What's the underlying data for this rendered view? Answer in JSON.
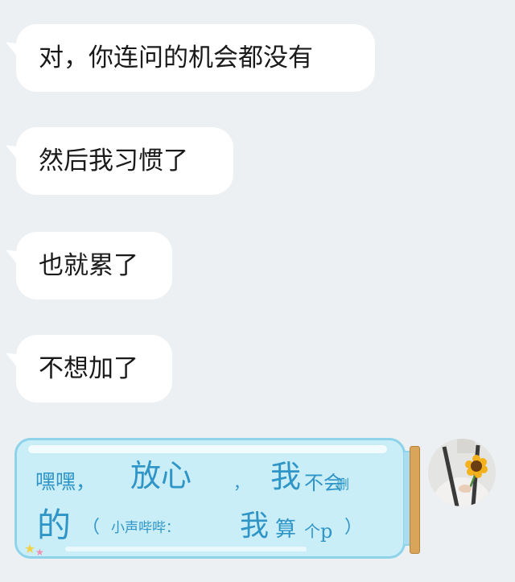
{
  "messages": [
    {
      "text": "对，你连问的机会都没有"
    },
    {
      "text": "然后我习惯了"
    },
    {
      "text": "也就累了"
    },
    {
      "text": "不想加了"
    }
  ],
  "sticker": {
    "line1": [
      "嘿嘿，",
      "放心",
      "，",
      "我",
      "不会",
      "删"
    ],
    "line2": [
      "的",
      "（",
      "小声哔哔：",
      "我",
      "算",
      "个",
      "p",
      "）"
    ]
  },
  "colors": {
    "background": "#edf0f3",
    "bubble": "#ffffff",
    "handwriting": "#2f94c6",
    "bottle_glass": "#c9eef8",
    "cork": "#d9a55a"
  },
  "icons": {
    "avatar": "avatar-sunflower",
    "decor": "star-icon"
  }
}
